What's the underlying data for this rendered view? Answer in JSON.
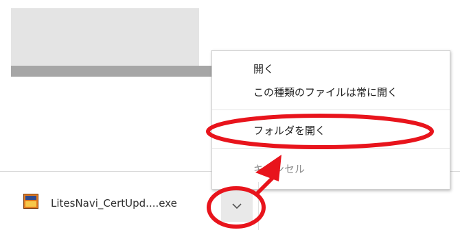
{
  "menu": {
    "items": [
      {
        "label": "開く",
        "enabled": true
      },
      {
        "label": "この種類のファイルは常に開く",
        "enabled": true
      },
      {
        "label": "フォルダを開く",
        "enabled": true
      },
      {
        "label": "キャンセル",
        "enabled": false
      }
    ]
  },
  "download": {
    "filename": "LitesNavi_CertUpd....exe",
    "icon": "app-file-icon",
    "options_icon": "chevron-down-icon"
  },
  "colors": {
    "annotation": "#e8141c",
    "menu_border": "#cfcfcf",
    "button_bg": "#e9e9e9"
  }
}
